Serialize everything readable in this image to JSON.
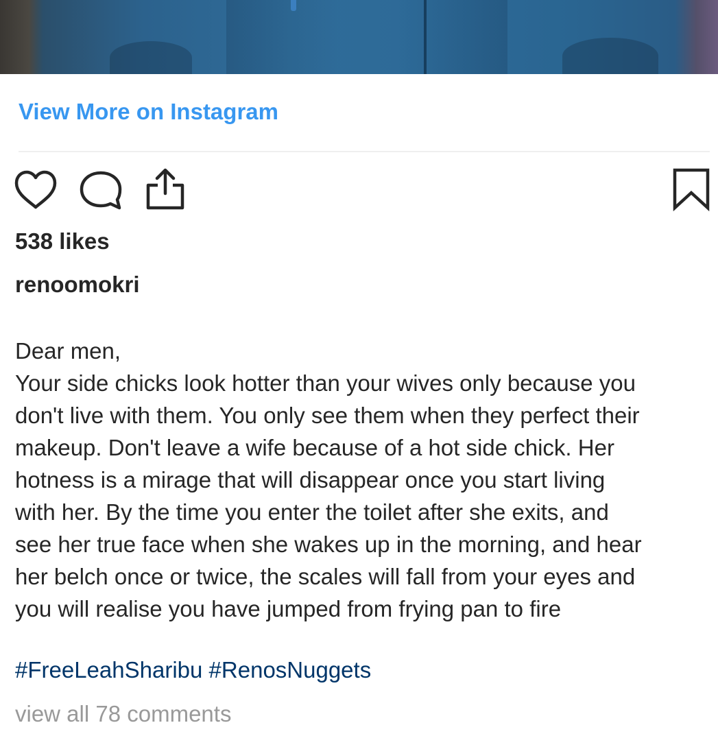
{
  "post": {
    "view_more_label": "View More on Instagram",
    "likes_text": "538 likes",
    "username": "renoomokri",
    "caption_lines": [
      "Dear men,",
      "Your side chicks look hotter than your wives only because you",
      "don't live with them. You only see them when they perfect their",
      "makeup. Don't leave a wife because of a hot side chick. Her",
      "hotness is a mirage that will disappear once you start living",
      "with her. By the time you enter the toilet after she exits, and",
      "see her true face when she wakes up in the morning, and hear",
      "her belch once or twice, the scales will fall from your eyes and",
      "you will realise you have jumped from frying pan to fire"
    ],
    "hashtags": [
      "#FreeLeahSharibu",
      "#RenosNuggets"
    ],
    "view_comments_label": "view all 78 comments"
  },
  "icons": {
    "like": "heart-icon",
    "comment": "speech-bubble-icon",
    "share": "share-upload-icon",
    "save": "bookmark-icon"
  },
  "colors": {
    "link_blue": "#3897f0",
    "hashtag_blue": "#003569",
    "muted_gray": "#999999",
    "text": "#262626"
  }
}
